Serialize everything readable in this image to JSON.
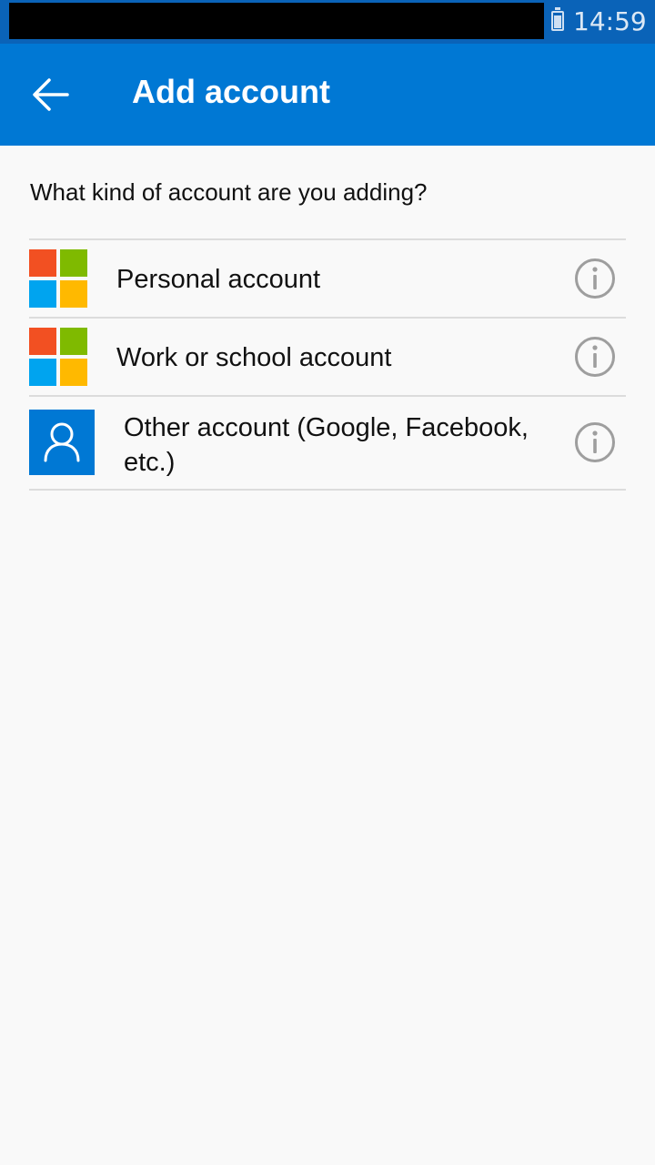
{
  "status_bar": {
    "time": "14:59",
    "battery_icon": "battery-icon"
  },
  "app_bar": {
    "title": "Add account",
    "back_icon": "arrow-back-icon",
    "color": "#0078d4"
  },
  "prompt": "What kind of account are you adding?",
  "accounts": [
    {
      "label": "Personal account",
      "icon": "microsoft-logo-icon"
    },
    {
      "label": "Work or school account",
      "icon": "microsoft-logo-icon"
    },
    {
      "label": "Other account (Google, Facebook, etc.)",
      "icon": "person-icon"
    }
  ],
  "info_icon": "info-icon",
  "colors": {
    "ms_red": "#f25022",
    "ms_green": "#7fba00",
    "ms_blue": "#00a4ef",
    "ms_yellow": "#ffb900"
  }
}
